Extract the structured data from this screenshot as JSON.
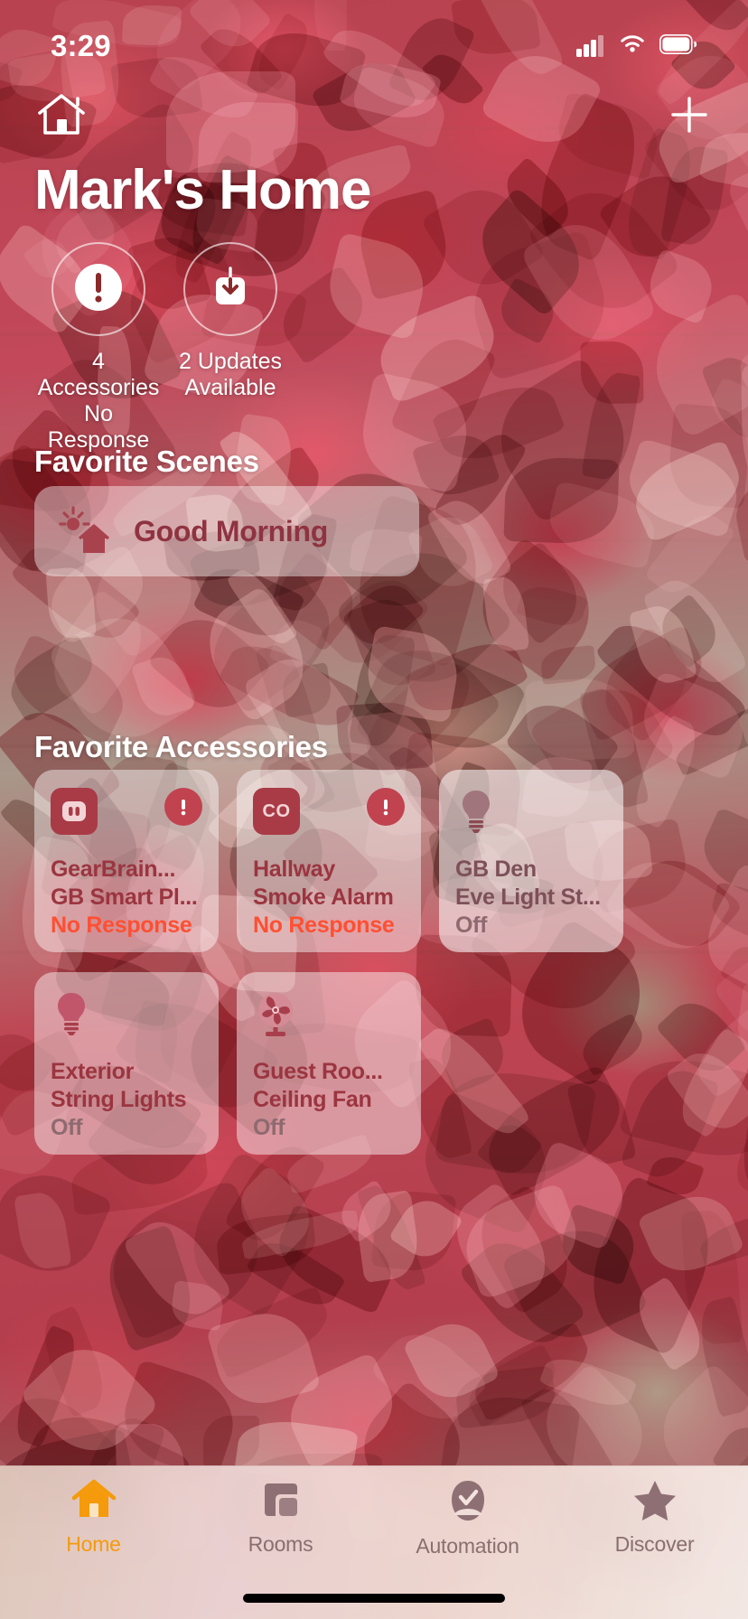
{
  "status_bar": {
    "time": "3:29",
    "cellular_icon": "cellular-signal-icon",
    "wifi_icon": "wifi-icon",
    "battery_icon": "battery-icon"
  },
  "nav": {
    "home_icon": "home-outline-icon",
    "add_icon": "plus-icon"
  },
  "header": {
    "title": "Mark's Home"
  },
  "status_items": [
    {
      "icon": "exclamation-circle-icon",
      "line1": "4 Accessories",
      "line2": "No Response"
    },
    {
      "icon": "download-square-icon",
      "line1": "2 Updates",
      "line2": "Available"
    }
  ],
  "scenes": {
    "section_title": "Favorite Scenes",
    "items": [
      {
        "icon": "sunrise-house-icon",
        "name": "Good Morning"
      }
    ]
  },
  "accessories": {
    "section_title": "Favorite Accessories",
    "items": [
      {
        "icon": "outlet-icon",
        "badge": "exclamation-badge-icon",
        "line1": "GearBrain...",
        "line2": "GB Smart Pl...",
        "state": "No Response",
        "state_kind": "noresponse"
      },
      {
        "icon": "co-sensor-icon",
        "badge": "exclamation-badge-icon",
        "line1": "Hallway",
        "line2": "Smoke Alarm",
        "state": "No Response",
        "state_kind": "noresponse"
      },
      {
        "icon": "lightbulb-icon",
        "badge": null,
        "line1": "GB Den",
        "line2": "Eve Light St...",
        "state": "Off",
        "state_kind": "off"
      },
      {
        "icon": "lightbulb-icon",
        "badge": null,
        "line1": "Exterior",
        "line2": "String Lights",
        "state": "Off",
        "state_kind": "off"
      },
      {
        "icon": "fan-icon",
        "badge": null,
        "line1": "Guest Roo...",
        "line2": "Ceiling Fan",
        "state": "Off",
        "state_kind": "off"
      }
    ]
  },
  "tabbar": {
    "items": [
      {
        "label": "Home",
        "icon": "home-filled-icon",
        "active": true
      },
      {
        "label": "Rooms",
        "icon": "rooms-icon",
        "active": false
      },
      {
        "label": "Automation",
        "icon": "automation-clock-icon",
        "active": false
      },
      {
        "label": "Discover",
        "icon": "star-icon",
        "active": false
      }
    ]
  },
  "colors": {
    "accent": "#f59a0b",
    "alert_red": "#ff4f32",
    "card_text": "#9b3540",
    "icon_red": "#a93b46"
  }
}
